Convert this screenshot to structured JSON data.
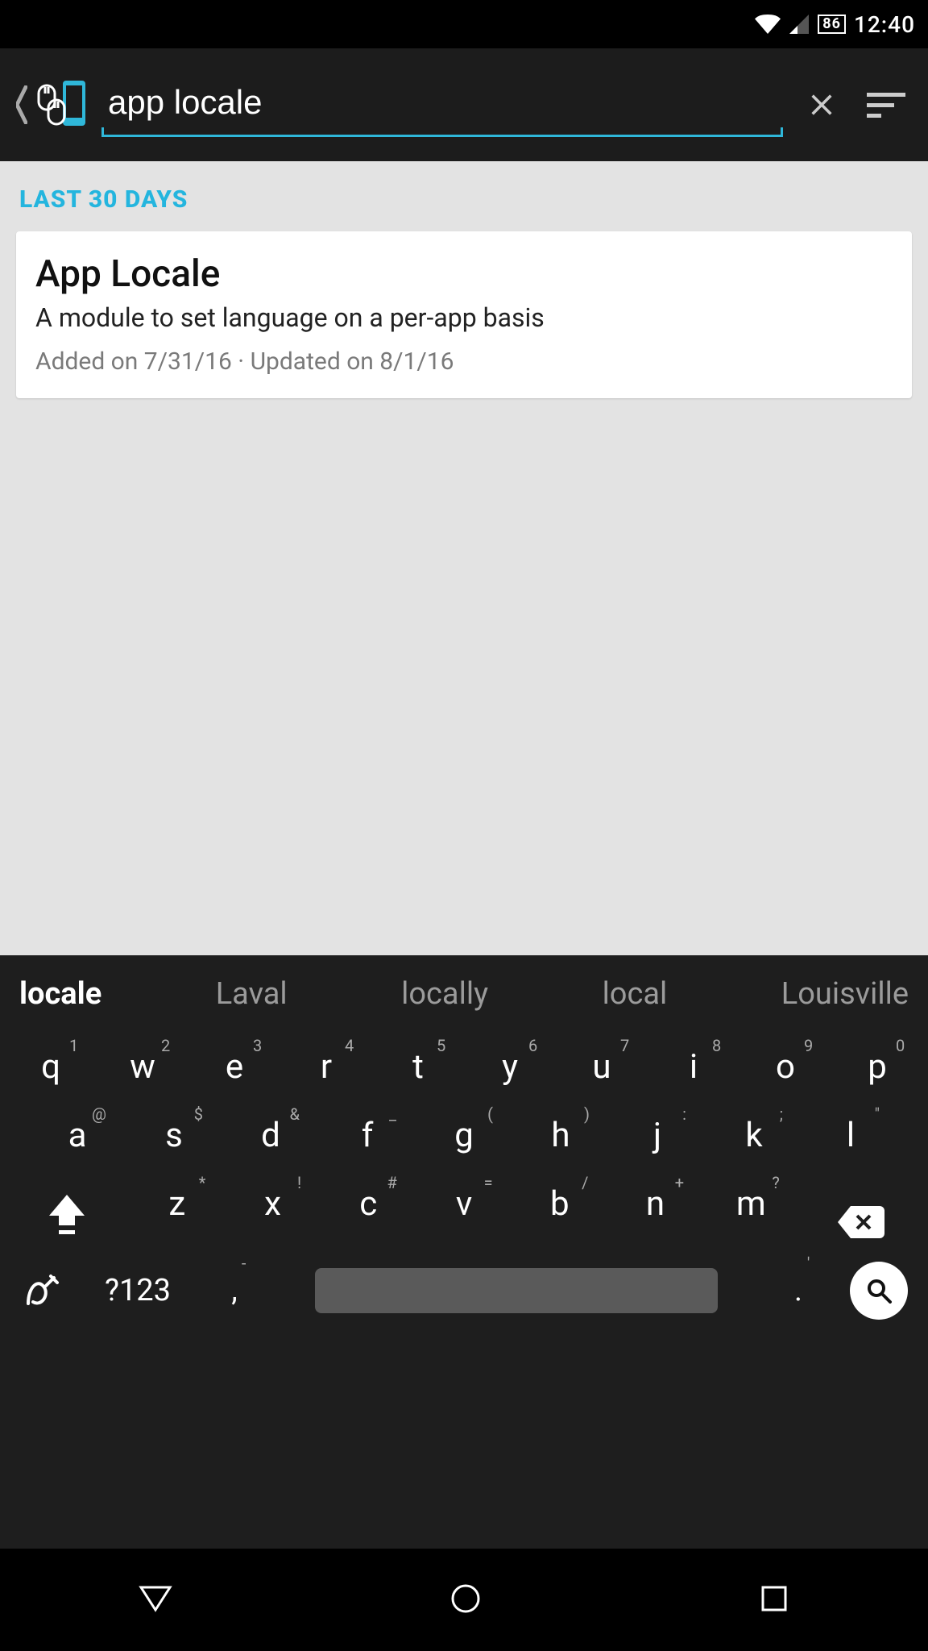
{
  "status": {
    "battery": "86",
    "time": "12:40"
  },
  "toolbar": {
    "search_value": "app locale"
  },
  "section": {
    "header": "LAST 30 DAYS"
  },
  "result": {
    "title": "App Locale",
    "description": "A module to set language on a per-app basis",
    "meta": "Added on 7/31/16 · Updated on 8/1/16"
  },
  "keyboard": {
    "suggestions": [
      "locale",
      "Laval",
      "locally",
      "local",
      "Louisville"
    ],
    "row1": [
      {
        "m": "q",
        "s": "1"
      },
      {
        "m": "w",
        "s": "2"
      },
      {
        "m": "e",
        "s": "3"
      },
      {
        "m": "r",
        "s": "4"
      },
      {
        "m": "t",
        "s": "5"
      },
      {
        "m": "y",
        "s": "6"
      },
      {
        "m": "u",
        "s": "7"
      },
      {
        "m": "i",
        "s": "8"
      },
      {
        "m": "o",
        "s": "9"
      },
      {
        "m": "p",
        "s": "0"
      }
    ],
    "row2": [
      {
        "m": "a",
        "s": "@"
      },
      {
        "m": "s",
        "s": "$"
      },
      {
        "m": "d",
        "s": "&"
      },
      {
        "m": "f",
        "s": "_"
      },
      {
        "m": "g",
        "s": "("
      },
      {
        "m": "h",
        "s": ")"
      },
      {
        "m": "j",
        "s": ":"
      },
      {
        "m": "k",
        "s": ";"
      },
      {
        "m": "l",
        "s": "\""
      }
    ],
    "row3": [
      {
        "m": "z",
        "s": "*"
      },
      {
        "m": "x",
        "s": "!"
      },
      {
        "m": "c",
        "s": "#"
      },
      {
        "m": "v",
        "s": "="
      },
      {
        "m": "b",
        "s": "/"
      },
      {
        "m": "n",
        "s": "+"
      },
      {
        "m": "m",
        "s": "?"
      }
    ],
    "mode_label": "?123",
    "comma": {
      "m": ",",
      "s": "-"
    },
    "period": {
      "m": ".",
      "s": "'"
    }
  }
}
